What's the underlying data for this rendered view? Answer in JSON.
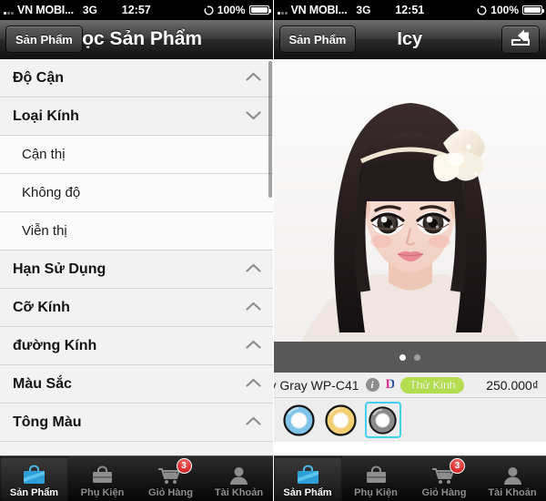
{
  "status_bar": {
    "carrier": "VN MOBI...",
    "network": "3G",
    "battery_percent": "100%",
    "time_left": "12:57",
    "time_right": "12:51",
    "signal_icon": "signal-bars-icon",
    "sync_icon": "sync-icon",
    "battery_icon": "battery-icon"
  },
  "colors": {
    "accent_selected": "#3fd2f0",
    "badge_green": "#b5dd50",
    "badge_red": "#cc1111",
    "tab_active_text": "#ffffff",
    "tab_inactive_text": "#8f8f8f",
    "carousel_strip": "#585858"
  },
  "left_screen": {
    "nav": {
      "back_label": "Sản Phẩm",
      "title": "Lọc Sản Phẩm"
    },
    "filters": [
      {
        "label": "Độ Cận",
        "type": "header",
        "chevron": "chevron-up-icon",
        "expanded": false
      },
      {
        "label": "Loại Kính",
        "type": "header",
        "chevron": "chevron-down-icon",
        "expanded": true
      },
      {
        "label": "Cận thị",
        "type": "child",
        "chevron": "",
        "expanded": false
      },
      {
        "label": "Không độ",
        "type": "child",
        "chevron": "",
        "expanded": false
      },
      {
        "label": "Viễn thị",
        "type": "child",
        "chevron": "",
        "expanded": false
      },
      {
        "label": "Hạn Sử Dụng",
        "type": "header",
        "chevron": "chevron-up-icon",
        "expanded": false
      },
      {
        "label": "Cỡ Kính",
        "type": "header",
        "chevron": "chevron-up-icon",
        "expanded": false
      },
      {
        "label": "đường Kính",
        "type": "header",
        "chevron": "chevron-up-icon",
        "expanded": false
      },
      {
        "label": "Màu Sắc",
        "type": "header",
        "chevron": "chevron-up-icon",
        "expanded": false
      },
      {
        "label": "Tông Màu",
        "type": "header",
        "chevron": "chevron-up-icon",
        "expanded": false
      }
    ]
  },
  "right_screen": {
    "nav": {
      "back_label": "Sản Phẩm",
      "title": "Icy",
      "share_icon": "share-icon"
    },
    "product": {
      "name": "y Gray WP-C41",
      "info_icon": "info-icon",
      "brand_icon": "brand-d-icon",
      "try_badge": "Thử Kính",
      "price": "250.000₫"
    },
    "carousel": {
      "dots": 2,
      "active_index": 0
    },
    "swatches": [
      {
        "name": "swatch-blue",
        "color": "#7fc3e8",
        "selected": false
      },
      {
        "name": "swatch-gold",
        "color": "#f2cf72",
        "selected": false
      },
      {
        "name": "swatch-gray",
        "color": "#8a8a8a",
        "selected": true
      }
    ]
  },
  "tab_bar": {
    "items": [
      {
        "label": "Sản Phẩm",
        "icon": "bag-icon",
        "active": true,
        "badge": ""
      },
      {
        "label": "Phụ Kiện",
        "icon": "case-icon",
        "active": false,
        "badge": ""
      },
      {
        "label": "Giỏ Hàng",
        "icon": "cart-icon",
        "active": false,
        "badge": "3"
      },
      {
        "label": "Tài Khoản",
        "icon": "person-icon",
        "active": false,
        "badge": ""
      }
    ]
  }
}
